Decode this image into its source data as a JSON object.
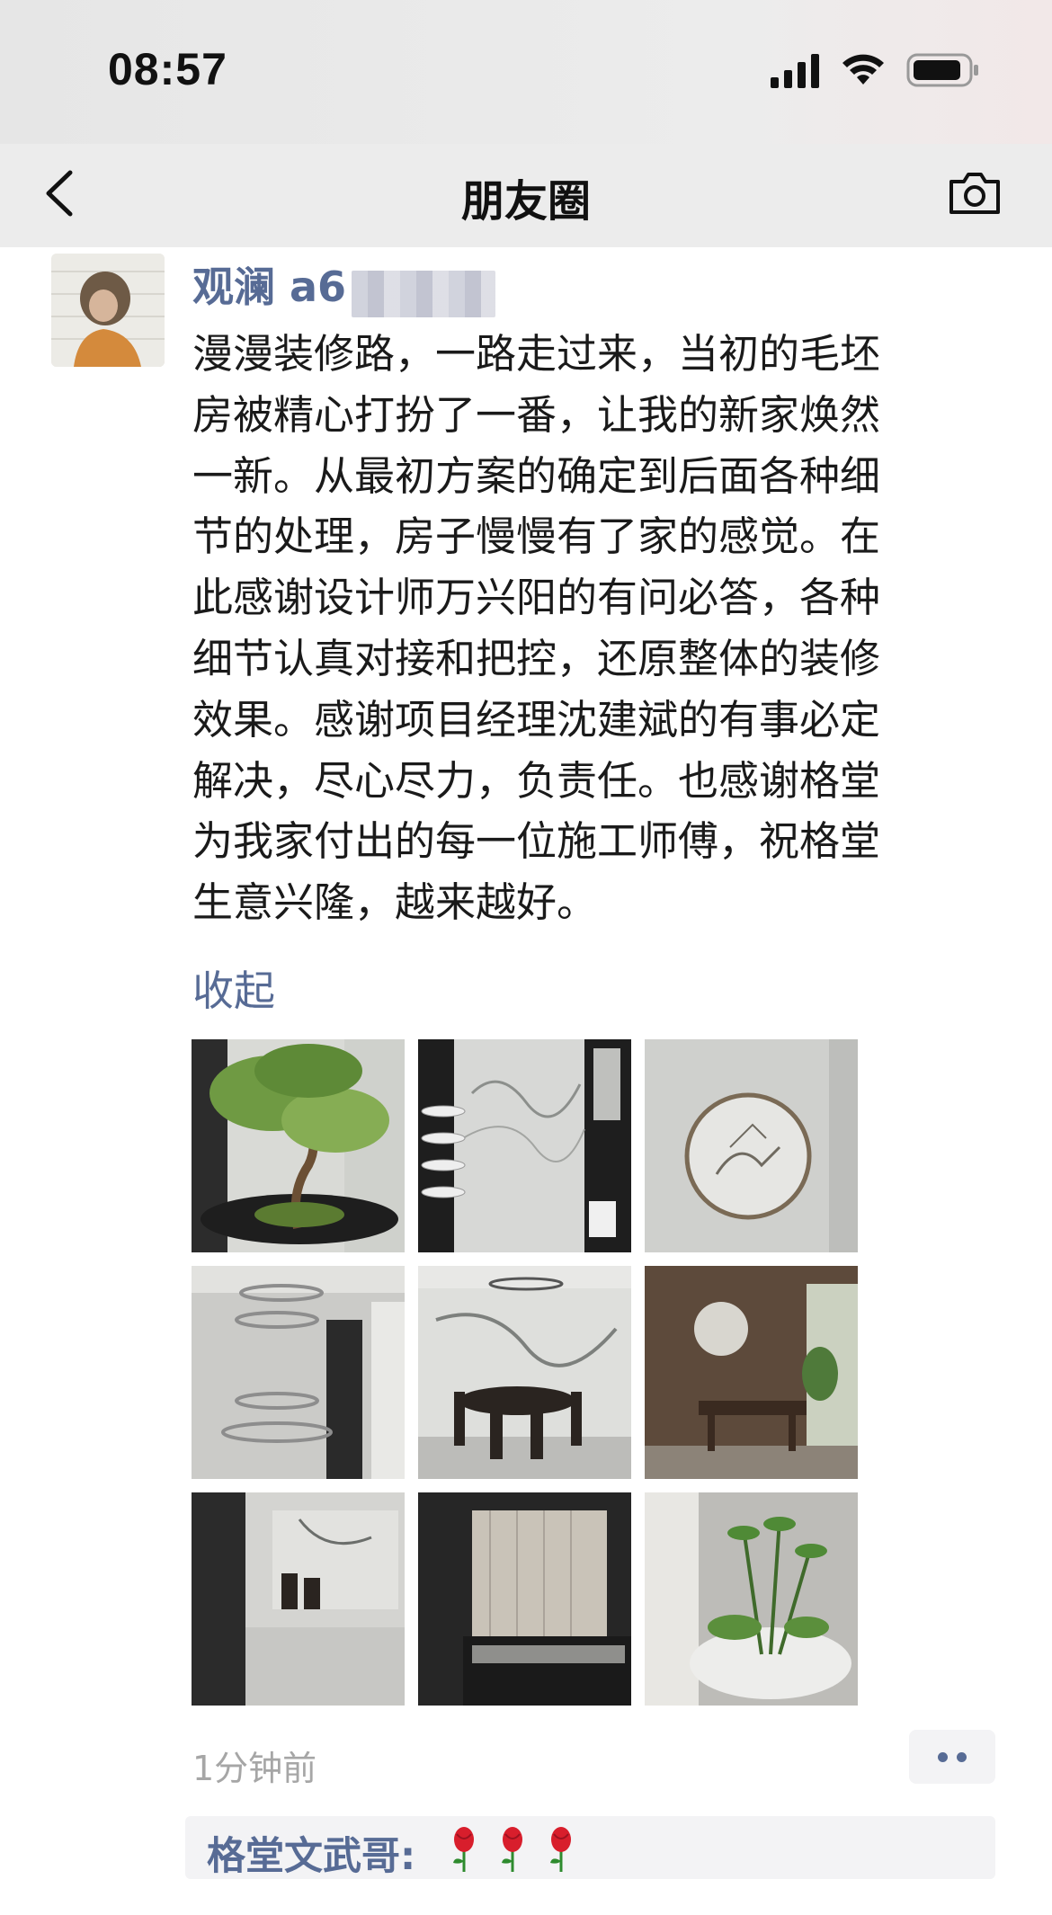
{
  "status_bar": {
    "time": "08:57",
    "icons": [
      "signal-icon",
      "wifi-icon",
      "battery-icon"
    ]
  },
  "nav": {
    "title": "朋友圈",
    "back_icon": "chevron-left-icon",
    "camera_icon": "camera-icon"
  },
  "post": {
    "author": "观澜 a6",
    "text_lines": [
      "漫漫装修路，一路走过来，当初的毛坯",
      "房被精心打扮了一番，让我的新家焕然",
      "一新。从最初方案的确定到后面各种细",
      "节的处理，房子慢慢有了家的感觉。在",
      "此感谢设计师万兴阳的有问必答，各种",
      "细节认真对接和把控，还原整体的装修",
      "效果。感谢项目经理沈建斌的有事必定",
      "解决，尽心尽力，负责任。也感谢格堂",
      "为我家付出的每一位施工师傅，祝格堂",
      "生意兴隆，越来越好。"
    ],
    "collapse_label": "收起",
    "photos": [
      {
        "icon": "bonsai-photo"
      },
      {
        "icon": "marble-wall-photo"
      },
      {
        "icon": "round-wall-art-photo"
      },
      {
        "icon": "chandelier-photo"
      },
      {
        "icon": "dining-room-photo"
      },
      {
        "icon": "tea-room-photo"
      },
      {
        "icon": "hallway-photo"
      },
      {
        "icon": "window-cabinet-photo"
      },
      {
        "icon": "indoor-garden-photo"
      }
    ],
    "timestamp": "1分钟前",
    "more_icon": "more-dots-icon"
  },
  "comments": [
    {
      "author": "格堂文武哥",
      "separator": ":",
      "emoji": "rose-icon",
      "emoji_count": 3
    }
  ],
  "colors": {
    "link_blue": "#576b95",
    "nav_bg": "#ececec",
    "timestamp_gray": "#a6a6a6",
    "comment_bg": "#f3f3f5",
    "rose_red": "#d81e2c"
  }
}
